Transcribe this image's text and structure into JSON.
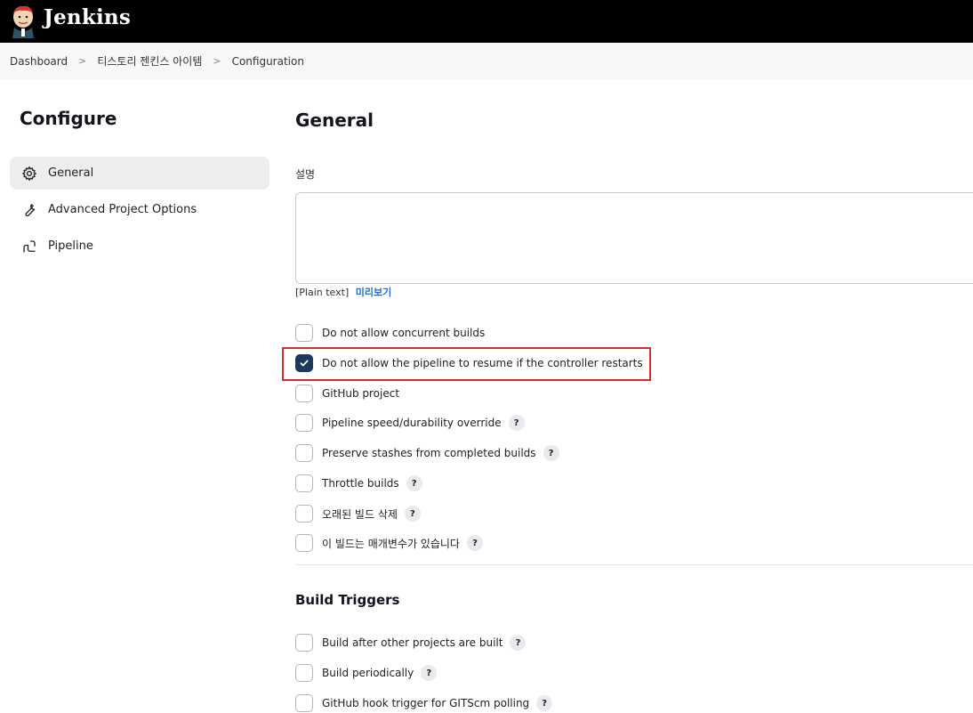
{
  "app": {
    "brand": "Jenkins"
  },
  "breadcrumb": [
    "Dashboard",
    "티스토리 젠킨스 아이템",
    "Configuration"
  ],
  "sidebar": {
    "title": "Configure",
    "items": [
      {
        "label": "General",
        "icon": "gear-icon",
        "active": true
      },
      {
        "label": "Advanced Project Options",
        "icon": "wrench-icon",
        "active": false
      },
      {
        "label": "Pipeline",
        "icon": "pipeline-icon",
        "active": false
      }
    ]
  },
  "general": {
    "heading": "General",
    "description_label": "설명",
    "description_value": "",
    "plain_text": "[Plain text]",
    "preview_link": "미리보기",
    "options": [
      {
        "label": "Do not allow concurrent builds",
        "checked": false,
        "help": false
      },
      {
        "label": "Do not allow the pipeline to resume if the controller restarts",
        "checked": true,
        "help": false
      },
      {
        "label": "GitHub project",
        "checked": false,
        "help": false
      },
      {
        "label": "Pipeline speed/durability override",
        "checked": false,
        "help": true
      },
      {
        "label": "Preserve stashes from completed builds",
        "checked": false,
        "help": true
      },
      {
        "label": "Throttle builds",
        "checked": false,
        "help": true
      },
      {
        "label": "오래된 빌드 삭제",
        "checked": false,
        "help": true
      },
      {
        "label": "이 빌드는 매개변수가 있습니다",
        "checked": false,
        "help": true
      }
    ]
  },
  "build_triggers": {
    "heading": "Build Triggers",
    "options": [
      {
        "label": "Build after other projects are built",
        "checked": false,
        "help": true
      },
      {
        "label": "Build periodically",
        "checked": false,
        "help": true
      },
      {
        "label": "GitHub hook trigger for GITScm polling",
        "checked": false,
        "help": true
      }
    ]
  },
  "help_glyph": "?",
  "colors": {
    "topbar": "#000000",
    "checkbox_checked": "#1d3a5c",
    "highlight": "#d32f2f",
    "link": "#1f6ed6"
  }
}
